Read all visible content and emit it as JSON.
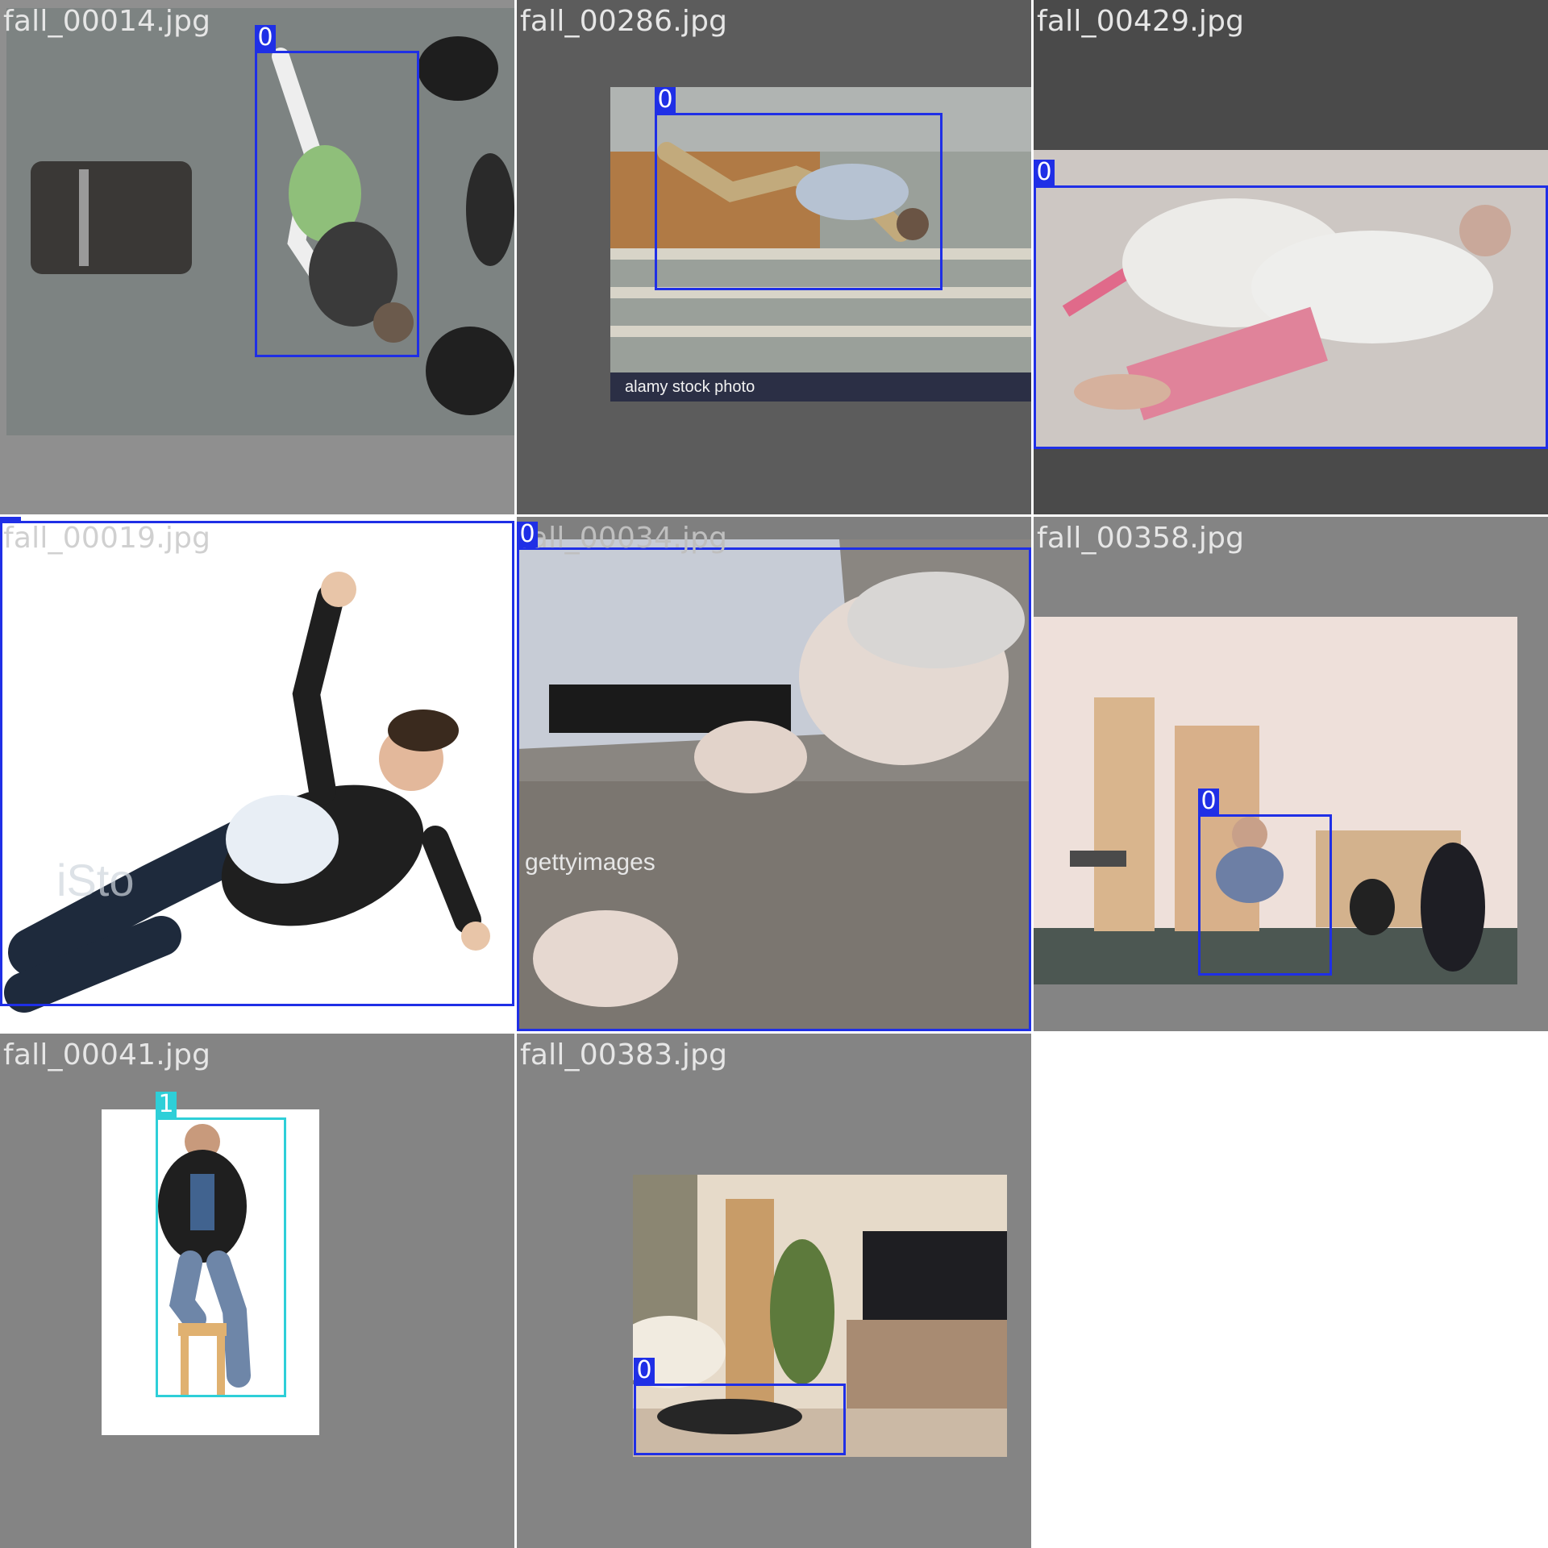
{
  "mosaic": {
    "tiles": [
      {
        "filename": "fall_00014.jpg",
        "boxes": [
          {
            "class_id": "0"
          }
        ]
      },
      {
        "filename": "fall_00286.jpg",
        "boxes": [
          {
            "class_id": "0"
          }
        ],
        "watermark": "alamy stock photo"
      },
      {
        "filename": "fall_00429.jpg",
        "boxes": [
          {
            "class_id": "0"
          }
        ]
      },
      {
        "filename": "fall_00019.jpg",
        "boxes": [
          {
            "class_id": "0"
          }
        ],
        "watermark": "iSto"
      },
      {
        "filename": "fall_00034.jpg",
        "boxes": [
          {
            "class_id": "0"
          }
        ],
        "watermark": "gettyimages"
      },
      {
        "filename": "fall_00358.jpg",
        "boxes": [
          {
            "class_id": "0"
          }
        ]
      },
      {
        "filename": "fall_00041.jpg",
        "boxes": [
          {
            "class_id": "1"
          }
        ]
      },
      {
        "filename": "fall_00383.jpg",
        "boxes": [
          {
            "class_id": "0"
          }
        ]
      }
    ]
  },
  "colors": {
    "class_0": "#1f2fe6",
    "class_1": "#2ecfd8",
    "pad_gray": "#8a8a8a",
    "label_text": "#e6e6e6"
  }
}
